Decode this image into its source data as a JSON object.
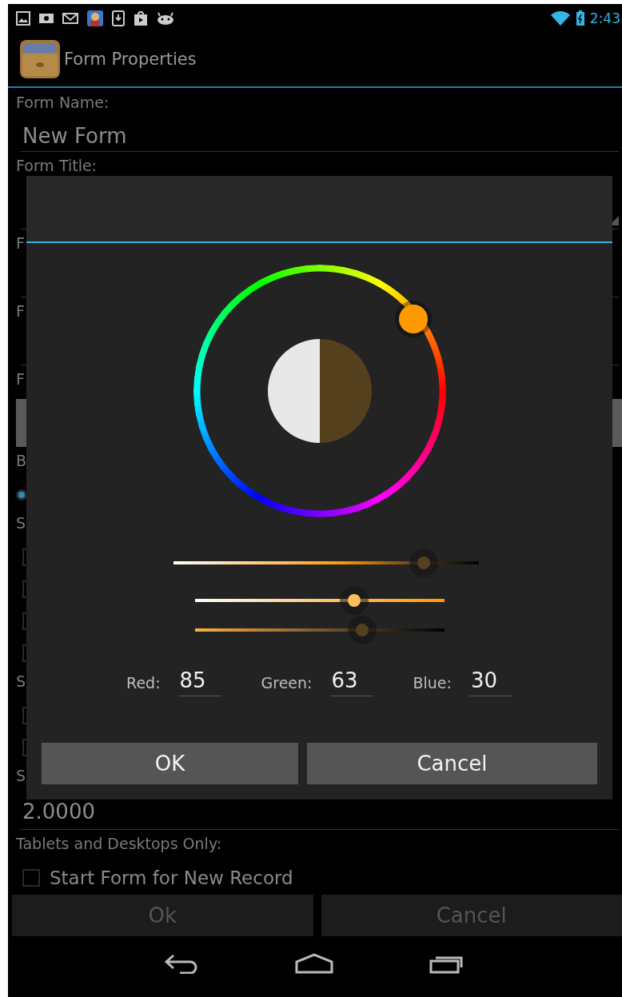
{
  "status_bar": {
    "time": "2:43"
  },
  "action_bar": {
    "title": "Form Properties"
  },
  "form_rows": [
    {
      "kind": "label",
      "text": "Form Name:"
    },
    {
      "kind": "field",
      "value": "New Form"
    },
    {
      "kind": "label",
      "text": "Form Title:"
    },
    {
      "kind": "spinner"
    },
    {
      "kind": "label",
      "text": "F"
    },
    {
      "kind": "field"
    },
    {
      "kind": "label",
      "text": "F"
    },
    {
      "kind": "field"
    },
    {
      "kind": "label",
      "text": "F"
    },
    {
      "kind": "bar"
    },
    {
      "kind": "label",
      "text": "B"
    },
    {
      "kind": "radio",
      "checked": true
    },
    {
      "kind": "label",
      "text": "S"
    },
    {
      "kind": "checkbox",
      "checked": false
    },
    {
      "kind": "checkbox",
      "checked": false
    },
    {
      "kind": "checkbox",
      "checked": false
    },
    {
      "kind": "checkbox",
      "checked": false
    },
    {
      "kind": "label",
      "text": "S"
    },
    {
      "kind": "checkbox",
      "checked": false
    },
    {
      "kind": "checkbox",
      "checked": false
    },
    {
      "kind": "label",
      "text": "S"
    },
    {
      "kind": "field",
      "value": "2.0000"
    },
    {
      "kind": "label",
      "text": "Tablets and Desktops Only:"
    },
    {
      "kind": "checkbox",
      "checked": false,
      "text": "Start Form for New Record"
    }
  ],
  "form_buttons": [
    "Ok",
    "Cancel"
  ],
  "dialog": {
    "sliders": [
      {
        "kind": "saturation",
        "level": 0.82
      },
      {
        "kind": "value",
        "level": 0.64
      },
      {
        "kind": "opacity",
        "level": 0.67
      }
    ],
    "channels": [
      {
        "label": "Red:",
        "value": "85"
      },
      {
        "label": "Green:",
        "value": "63"
      },
      {
        "label": "Blue:",
        "value": "30"
      }
    ],
    "buttons": [
      "OK",
      "Cancel"
    ]
  }
}
